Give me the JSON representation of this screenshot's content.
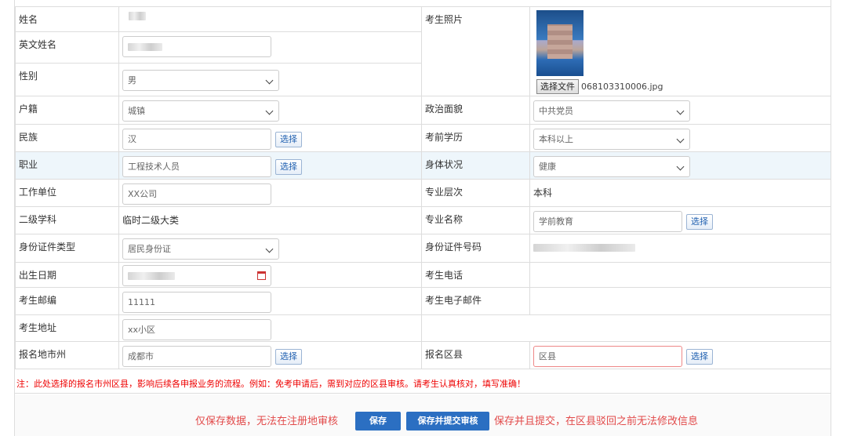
{
  "labels": {
    "name": "姓名",
    "photo": "考生照片",
    "en_name": "英文姓名",
    "gender": "性别",
    "hukou": "户籍",
    "political": "政治面貌",
    "ethnic": "民族",
    "edu_before": "考前学历",
    "job": "职业",
    "health": "身体状况",
    "work_unit": "工作单位",
    "major_level": "专业层次",
    "subject2": "二级学科",
    "major_name": "专业名称",
    "id_type": "身份证件类型",
    "id_no": "身份证件号码",
    "birth": "出生日期",
    "phone": "考生电话",
    "postcode": "考生邮编",
    "email": "考生电子邮件",
    "address": "考生地址",
    "city": "报名地市州",
    "county": "报名区县"
  },
  "values": {
    "gender": "男",
    "hukou": "城镇",
    "political": "中共党员",
    "ethnic": "汉",
    "edu_before": "本科以上",
    "job": "工程技术人员",
    "health": "健康",
    "work_unit": "XX公司",
    "major_level": "本科",
    "subject2": "临时二级大类",
    "major_name": "学前教育",
    "id_type": "居民身份证",
    "postcode": "11111",
    "address": "xx小区",
    "city": "成都市",
    "county_placeholder": "区县"
  },
  "photo": {
    "file_button": "选择文件",
    "file_name": "068103310006.jpg"
  },
  "pick_label": "选择",
  "note": "注：此处选择的报名市州区县，影响后续各申报业务的流程。例如：免考申请后，需到对应的区县审核。请考生认真核对，填写准确！",
  "footer": {
    "left_text": "仅保存数据，无法在注册地审核",
    "save_button": "保存",
    "submit_button": "保存并提交审核",
    "right_text": "保存并且提交，在区县驳回之前无法修改信息"
  },
  "colors": {
    "accent": "#2b6fc2",
    "warning": "#e00000",
    "highlight_row": "#eef6fb"
  }
}
